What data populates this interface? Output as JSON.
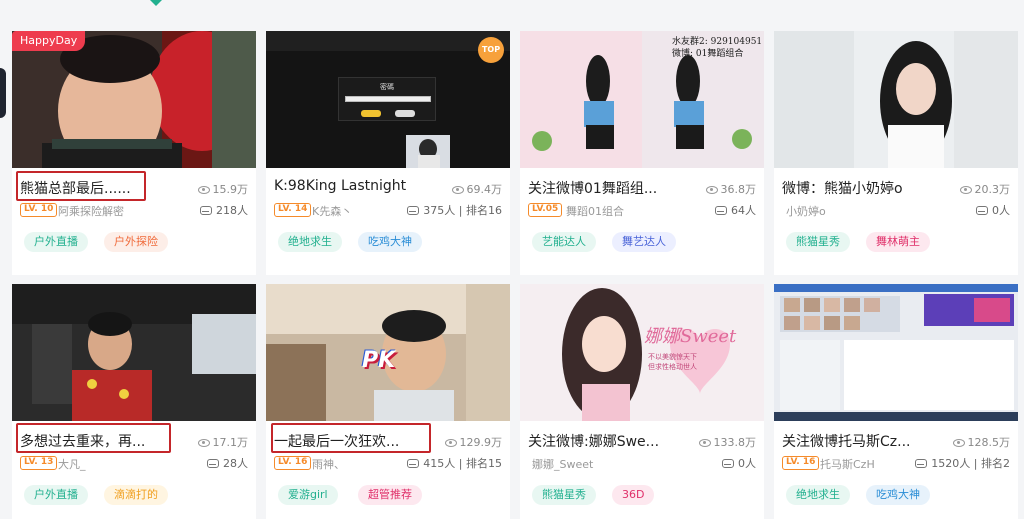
{
  "nav": {
    "active_indicator": "caret-down"
  },
  "cards": [
    {
      "title": "熊猫总部最后......",
      "views": "15.9万",
      "level": "LV. 10",
      "host": "阿乘探险解密",
      "viewers": "218人",
      "tags": [
        {
          "label": "户外直播",
          "color": "#22b08f",
          "bg": "#e8f7f2"
        },
        {
          "label": "户外探险",
          "color": "#f06a3a",
          "bg": "#fdeee8"
        }
      ],
      "badge": "HappyDay"
    },
    {
      "title": "K:98King Lastnight",
      "views": "69.4万",
      "level": "LV. 14",
      "host": "K先森丶",
      "viewers": "375人 | 排名16",
      "tags": [
        {
          "label": "绝地求生",
          "color": "#22b08f",
          "bg": "#e8f7f2"
        },
        {
          "label": "吃鸡大神",
          "color": "#2a8dd6",
          "bg": "#e7f2fb"
        }
      ],
      "badge": "TOP",
      "overlay": {
        "panel_title": "密碼"
      }
    },
    {
      "title": "关注微博01舞蹈组...",
      "views": "36.8万",
      "level": "LV.05",
      "host": "舞蹈01组合",
      "viewers": "64人",
      "tags": [
        {
          "label": "艺能达人",
          "color": "#22b08f",
          "bg": "#e8f7f2"
        },
        {
          "label": "舞艺达人",
          "color": "#4a64d8",
          "bg": "#ecefff"
        }
      ],
      "overlay": {
        "line1": "水友群2:  929104951",
        "line2": "微博: 01舞蹈组合"
      }
    },
    {
      "title": "微博：熊猫小奶婷o",
      "views": "20.3万",
      "level": "",
      "host": "小奶婷o",
      "viewers": "0人",
      "tags": [
        {
          "label": "熊猫星秀",
          "color": "#22b08f",
          "bg": "#e8f7f2"
        },
        {
          "label": "舞林萌主",
          "color": "#e0306a",
          "bg": "#fde8ef"
        }
      ]
    },
    {
      "title": "多想过去重来，再...",
      "views": "17.1万",
      "level": "LV. 13",
      "host": "大凡_",
      "viewers": "28人",
      "tags": [
        {
          "label": "户外直播",
          "color": "#22b08f",
          "bg": "#e8f7f2"
        },
        {
          "label": "滴滴打的",
          "color": "#f0a020",
          "bg": "#fff5e1"
        }
      ]
    },
    {
      "title": "一起最后一次狂欢...",
      "views": "129.9万",
      "level": "LV. 16",
      "host": "雨神、",
      "viewers": "415人 | 排名15",
      "tags": [
        {
          "label": "爱游girl",
          "color": "#22b08f",
          "bg": "#e8f7f2"
        },
        {
          "label": "超管推荐",
          "color": "#e0306a",
          "bg": "#fde8ef"
        }
      ],
      "overlay": {
        "pk": "PK"
      }
    },
    {
      "title": "关注微博:娜娜Swe...",
      "views": "133.8万",
      "level": "",
      "host": "娜娜_Sweet",
      "viewers": "0人",
      "tags": [
        {
          "label": "熊猫星秀",
          "color": "#22b08f",
          "bg": "#e8f7f2"
        },
        {
          "label": "36D",
          "color": "#e0306a",
          "bg": "#fde8ef"
        }
      ],
      "overlay": {
        "brand": "娜娜Sweet",
        "sub1": "不以美貌惊天下",
        "sub2": "但求性格动世人"
      }
    },
    {
      "title": "关注微博托马斯Cz...",
      "views": "128.5万",
      "level": "LV. 16",
      "host": "托马斯CzH",
      "viewers": "1520人 | 排名2",
      "tags": [
        {
          "label": "绝地求生",
          "color": "#22b08f",
          "bg": "#e8f7f2"
        },
        {
          "label": "吃鸡大神",
          "color": "#2a8dd6",
          "bg": "#e7f2fb"
        }
      ]
    }
  ]
}
